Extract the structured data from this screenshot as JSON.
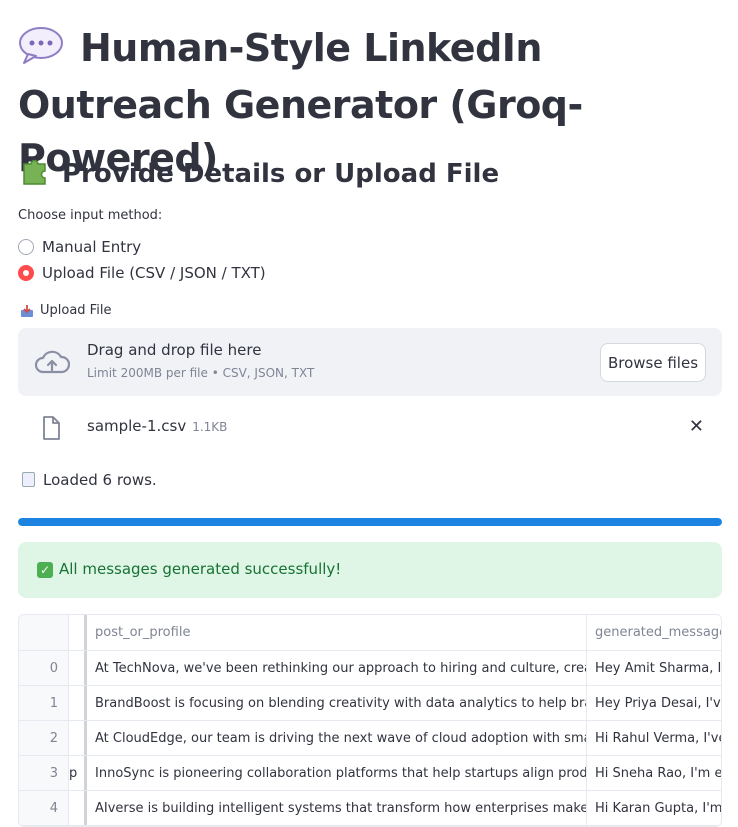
{
  "page": {
    "title": "Human-Style LinkedIn Outreach Generator (Groq-Powered)",
    "title_icon": "speech-balloon",
    "subheader": "Provide Details or Upload File",
    "subheader_icon": "puzzle-piece"
  },
  "input_method": {
    "label": "Choose input method:",
    "options": [
      "Manual Entry",
      "Upload File (CSV / JSON / TXT)"
    ],
    "selected": "Upload File (CSV / JSON / TXT)"
  },
  "uploader": {
    "label": "Upload File",
    "label_icon": "inbox-tray",
    "drag_text": "Drag and drop file here",
    "limit_text": "Limit 200MB per file • CSV, JSON, TXT",
    "browse_label": "Browse files",
    "file": {
      "name": "sample-1.csv",
      "size": "1.1KB"
    }
  },
  "status": {
    "loaded_text": "Loaded 6 rows.",
    "progress": 1.0,
    "success_text": "All messages generated successfully!"
  },
  "table": {
    "columns": [
      "",
      "post_or_profile",
      "generated_message"
    ],
    "rows": [
      {
        "index": "0",
        "prev": "",
        "post": "At TechNova, we've been rethinking our approach to hiring and culture, creating more",
        "message": "Hey Amit Sharma, I'm"
      },
      {
        "index": "1",
        "prev": "",
        "post": "BrandBoost is focusing on blending creativity with data analytics to help brands tell s",
        "message": "Hey Priya Desai, I've b"
      },
      {
        "index": "2",
        "prev": "",
        "post": "At CloudEdge, our team is driving the next wave of cloud adoption with smarter autom",
        "message": "Hi Rahul Verma,  I've b"
      },
      {
        "index": "3",
        "prev": "p",
        "post": "InnoSync is pioneering collaboration platforms that help startups align product, mar",
        "message": "Hi Sneha Rao, I'm exci"
      },
      {
        "index": "4",
        "prev": "",
        "post": "AIverse is building intelligent systems that transform how enterprises make real-time",
        "message": "Hi Karan Gupta, I'm cu"
      }
    ]
  },
  "colors": {
    "accent": "#ff4b4b",
    "progress": "#1c83e1",
    "success_bg": "#dff6e7",
    "success_text": "#177233"
  }
}
